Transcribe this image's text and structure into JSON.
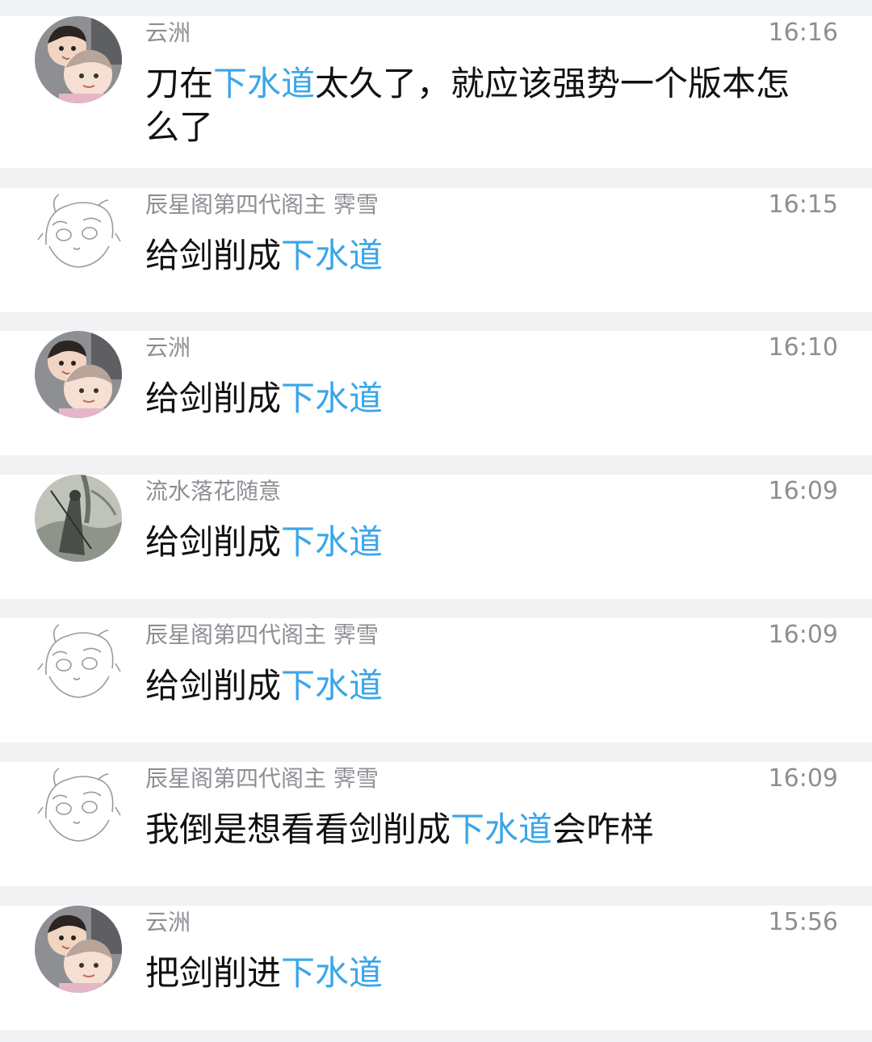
{
  "messages": [
    {
      "avatar": "child-photo-avatar",
      "name": "云洲",
      "time": "16:16",
      "text": [
        {
          "t": "刀在",
          "hl": false
        },
        {
          "t": "下水道",
          "hl": true
        },
        {
          "t": "太久了，就应该强势一个版本怎么了",
          "hl": false
        }
      ]
    },
    {
      "avatar": "anime-sketch-avatar",
      "name": "辰星阁第四代阁主 霁雪",
      "time": "16:15",
      "text": [
        {
          "t": "给剑削成",
          "hl": false
        },
        {
          "t": "下水道",
          "hl": true
        }
      ]
    },
    {
      "avatar": "child-photo-avatar",
      "name": "云洲",
      "time": "16:10",
      "text": [
        {
          "t": "给剑削成",
          "hl": false
        },
        {
          "t": "下水道",
          "hl": true
        }
      ]
    },
    {
      "avatar": "swordsman-painting-avatar",
      "name": "流水落花随意",
      "time": "16:09",
      "text": [
        {
          "t": "给剑削成",
          "hl": false
        },
        {
          "t": "下水道",
          "hl": true
        }
      ]
    },
    {
      "avatar": "anime-sketch-avatar",
      "name": "辰星阁第四代阁主 霁雪",
      "time": "16:09",
      "text": [
        {
          "t": "给剑削成",
          "hl": false
        },
        {
          "t": "下水道",
          "hl": true
        }
      ]
    },
    {
      "avatar": "anime-sketch-avatar",
      "name": "辰星阁第四代阁主 霁雪",
      "time": "16:09",
      "text": [
        {
          "t": "我倒是想看看剑削成",
          "hl": false
        },
        {
          "t": "下水道",
          "hl": true
        },
        {
          "t": "会咋样",
          "hl": false
        }
      ]
    },
    {
      "avatar": "child-photo-avatar",
      "name": "云洲",
      "time": "15:56",
      "text": [
        {
          "t": "把剑削进",
          "hl": false
        },
        {
          "t": "下水道",
          "hl": true
        }
      ]
    }
  ],
  "colors": {
    "background": "#f1f2f4",
    "card": "#ffffff",
    "meta_text": "#8d8f94",
    "body_text": "#111111",
    "keyword_highlight": "#3aa6e8"
  }
}
